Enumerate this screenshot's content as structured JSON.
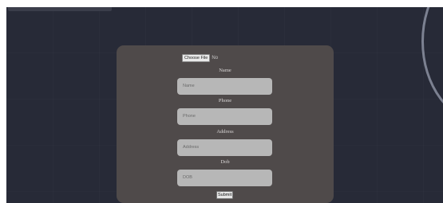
{
  "form": {
    "file": {
      "button_label": "Choose File",
      "status": "No"
    },
    "fields": [
      {
        "label": "Name",
        "placeholder": "Name"
      },
      {
        "label": "Phone",
        "placeholder": "Phone"
      },
      {
        "label": "Address",
        "placeholder": "Address"
      },
      {
        "label": "Dob",
        "placeholder": "DOB"
      }
    ],
    "submit_label": "Submit"
  },
  "colors": {
    "background": "#272a37",
    "card": "#4f4a4a",
    "input": "#b7b7b7"
  }
}
